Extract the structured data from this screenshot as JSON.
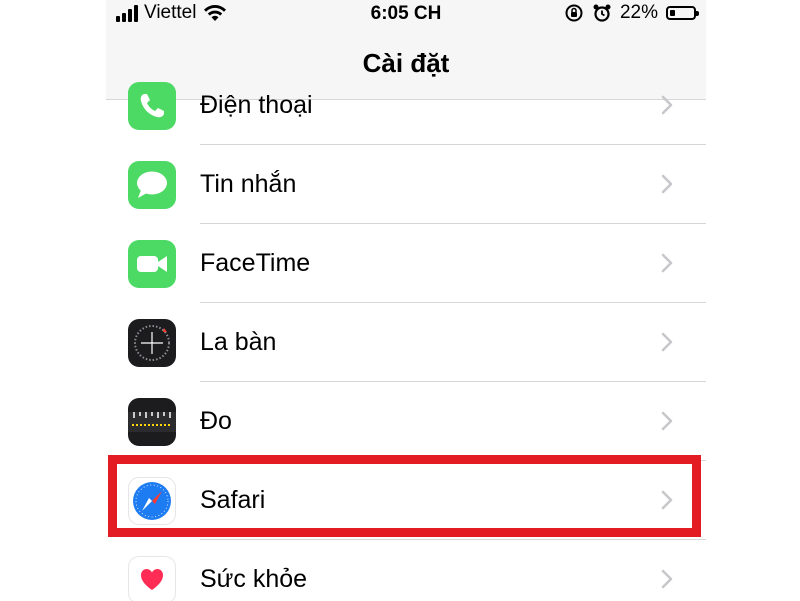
{
  "status_bar": {
    "carrier": "Viettel",
    "time": "6:05 CH",
    "battery_percent": "22%",
    "battery_level": 0.22
  },
  "header": {
    "title": "Cài đặt"
  },
  "settings": {
    "items": [
      {
        "label": "Điện thoại",
        "icon": "phone-icon",
        "color": "#4cd964"
      },
      {
        "label": "Tin nhắn",
        "icon": "messages-icon",
        "color": "#4cd964"
      },
      {
        "label": "FaceTime",
        "icon": "facetime-icon",
        "color": "#4cd964"
      },
      {
        "label": "La bàn",
        "icon": "compass-icon",
        "color": "#1c1c1e"
      },
      {
        "label": "Đo",
        "icon": "measure-icon",
        "color": "#1c1c1e"
      },
      {
        "label": "Safari",
        "icon": "safari-icon",
        "color": "#1e7cf2"
      },
      {
        "label": "Sức khỏe",
        "icon": "health-icon",
        "color": "#ff2d55"
      }
    ],
    "highlighted_item": "Safari"
  },
  "accent_colors": {
    "highlight": "#e31b23",
    "separator": "#d6d6d8",
    "chevron": "#c7c7cc"
  }
}
